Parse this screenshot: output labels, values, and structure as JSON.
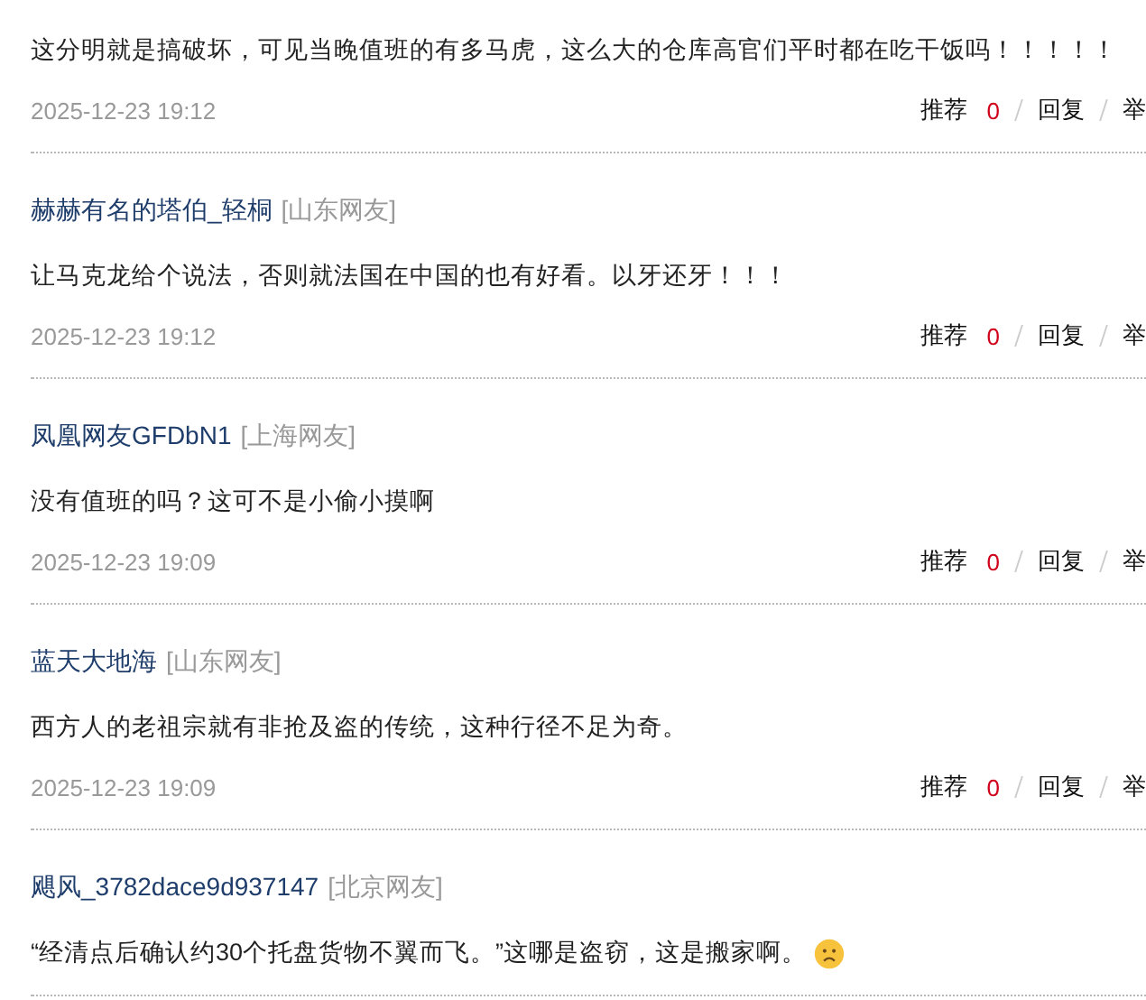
{
  "comments": [
    {
      "body": "这分明就是搞破坏，可见当晚值班的有多马虎，这么大的仓库高官们平时都在吃干饭吗！！！！！",
      "has_emoji": false,
      "time": "2025-12-23 19:12",
      "actions": {
        "recommend": "推荐",
        "count": "0",
        "reply": "回复",
        "report": "举"
      }
    },
    {
      "author": "赫赫有名的塔伯_轻桐",
      "region": "[山东网友]",
      "body": "让马克龙给个说法，否则就法国在中国的也有好看。以牙还牙！！！",
      "has_emoji": false,
      "time": "2025-12-23 19:12",
      "actions": {
        "recommend": "推荐",
        "count": "0",
        "reply": "回复",
        "report": "举"
      }
    },
    {
      "author": "凤凰网友GFDbN1",
      "region": "[上海网友]",
      "body": "没有值班的吗？这可不是小偷小摸啊",
      "has_emoji": false,
      "time": "2025-12-23 19:09",
      "actions": {
        "recommend": "推荐",
        "count": "0",
        "reply": "回复",
        "report": "举"
      }
    },
    {
      "author": "蓝天大地海",
      "region": "[山东网友]",
      "body": "西方人的老祖宗就有非抢及盗的传统，这种行径不足为奇。",
      "has_emoji": false,
      "time": "2025-12-23 19:09",
      "actions": {
        "recommend": "推荐",
        "count": "0",
        "reply": "回复",
        "report": "举"
      }
    },
    {
      "author": "飓风_3782dace9d937147",
      "region": "[北京网友]",
      "body": "“经清点后确认约30个托盘货物不翼而飞。”这哪是盗窃，这是搬家啊。",
      "has_emoji": true
    }
  ]
}
